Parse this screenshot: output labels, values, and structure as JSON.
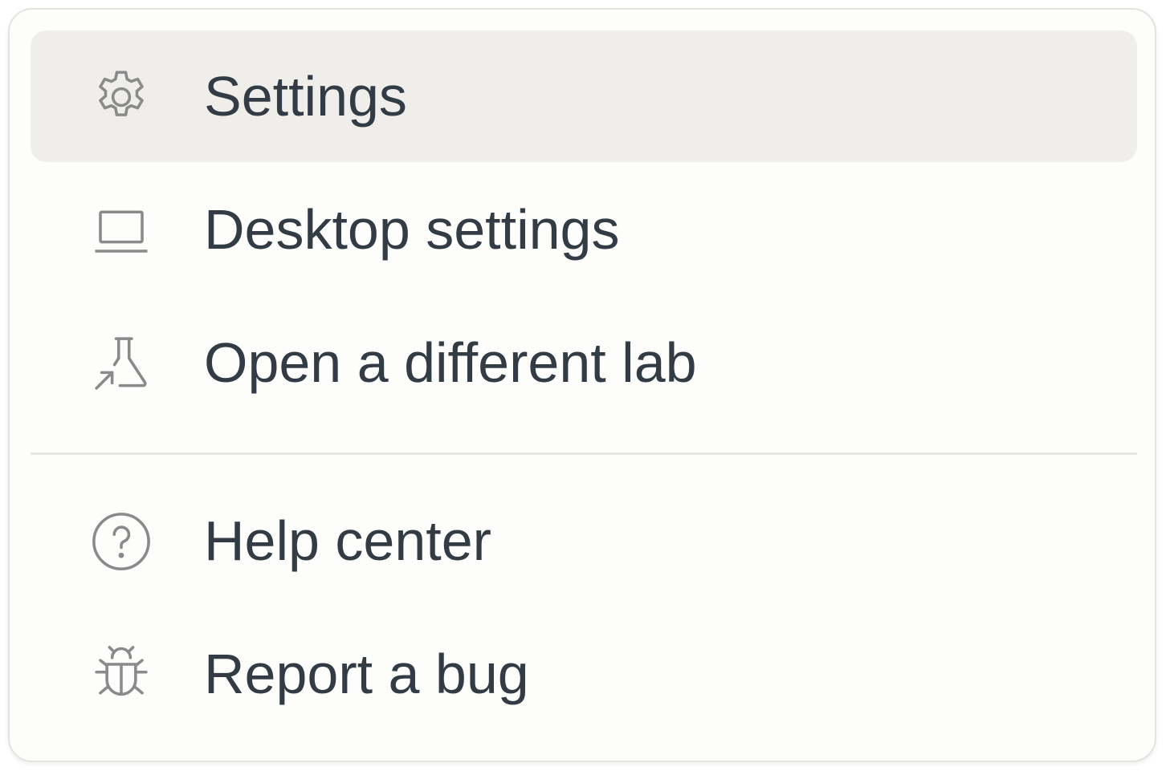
{
  "menu": {
    "items": [
      {
        "label": "Settings",
        "icon": "gear-icon",
        "active": true
      },
      {
        "label": "Desktop settings",
        "icon": "laptop-icon",
        "active": false
      },
      {
        "label": "Open a different lab",
        "icon": "flask-arrow-icon",
        "active": false
      },
      {
        "label": "Help center",
        "icon": "question-circle-icon",
        "active": false
      },
      {
        "label": "Report a bug",
        "icon": "bug-icon",
        "active": false
      }
    ]
  },
  "colors": {
    "text": "#333c44",
    "icon": "#8a8a8a",
    "highlight": "#efeeeb",
    "border": "#e3e3e0"
  }
}
